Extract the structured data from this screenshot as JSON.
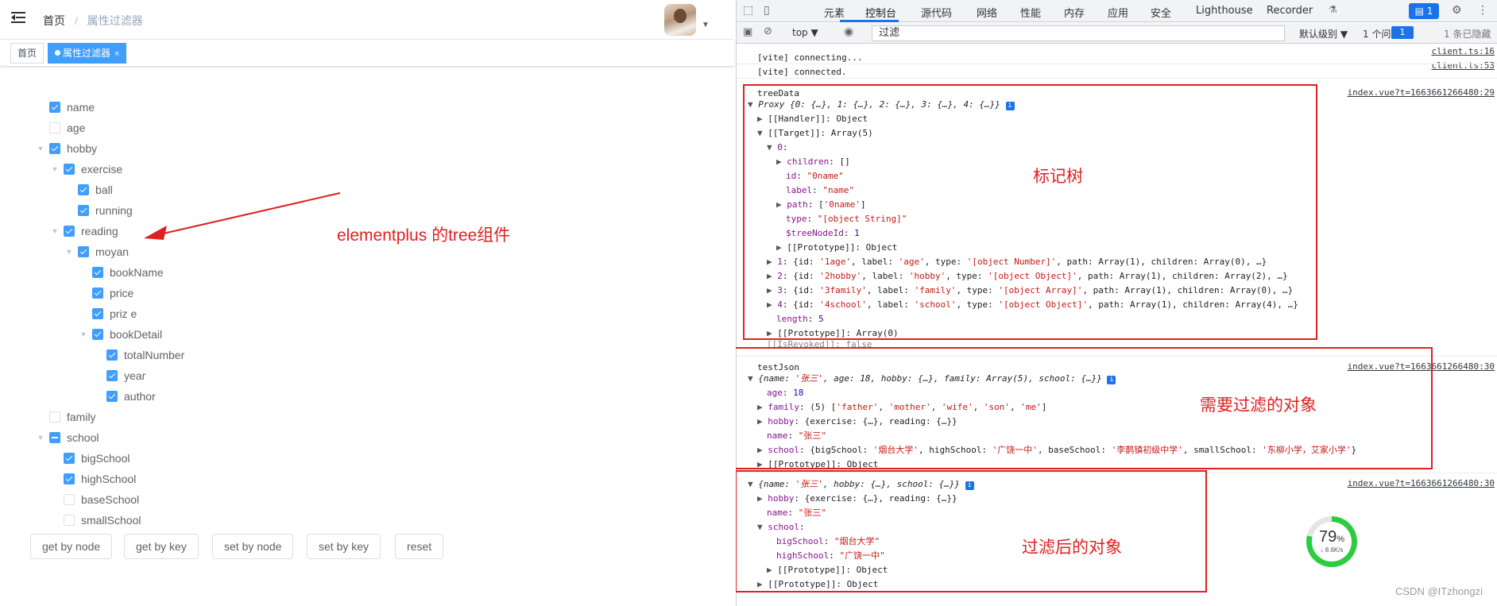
{
  "breadcrumb": {
    "home": "首页",
    "separator": "/",
    "current": "属性过滤器"
  },
  "tags": [
    {
      "label": "首页",
      "active": false
    },
    {
      "label": "属性过滤器",
      "active": true
    }
  ],
  "tree": [
    {
      "label": "name",
      "check": "on",
      "indent": 0,
      "arrow": ""
    },
    {
      "label": "age",
      "check": "off",
      "indent": 0,
      "arrow": ""
    },
    {
      "label": "hobby",
      "check": "on",
      "indent": 0,
      "arrow": "▼"
    },
    {
      "label": "exercise",
      "check": "on",
      "indent": 1,
      "arrow": "▼"
    },
    {
      "label": "ball",
      "check": "on",
      "indent": 2,
      "arrow": ""
    },
    {
      "label": "running",
      "check": "on",
      "indent": 2,
      "arrow": ""
    },
    {
      "label": "reading",
      "check": "on",
      "indent": 1,
      "arrow": "▼"
    },
    {
      "label": "moyan",
      "check": "on",
      "indent": 2,
      "arrow": "▼"
    },
    {
      "label": "bookName",
      "check": "on",
      "indent": 3,
      "arrow": ""
    },
    {
      "label": "price",
      "check": "on",
      "indent": 3,
      "arrow": ""
    },
    {
      "label": "priz e",
      "check": "on",
      "indent": 3,
      "arrow": ""
    },
    {
      "label": "bookDetail",
      "check": "on",
      "indent": 3,
      "arrow": "▼"
    },
    {
      "label": "totalNumber",
      "check": "on",
      "indent": 4,
      "arrow": ""
    },
    {
      "label": "year",
      "check": "on",
      "indent": 4,
      "arrow": ""
    },
    {
      "label": "author",
      "check": "on",
      "indent": 4,
      "arrow": ""
    },
    {
      "label": "family",
      "check": "off",
      "indent": 0,
      "arrow": ""
    },
    {
      "label": "school",
      "check": "half",
      "indent": 0,
      "arrow": "▼"
    },
    {
      "label": "bigSchool",
      "check": "on",
      "indent": 1,
      "arrow": ""
    },
    {
      "label": "highSchool",
      "check": "on",
      "indent": 1,
      "arrow": ""
    },
    {
      "label": "baseSchool",
      "check": "off",
      "indent": 1,
      "arrow": ""
    },
    {
      "label": "smallSchool",
      "check": "off",
      "indent": 1,
      "arrow": ""
    }
  ],
  "buttons": [
    "get by node",
    "get by key",
    "set by node",
    "set by key",
    "reset"
  ],
  "annotations": {
    "tree_component": "elementplus 的tree组件",
    "marked_tree": "标记树",
    "object_to_filter": "需要过滤的对象",
    "filtered_object": "过滤后的对象"
  },
  "devtools": {
    "tabs": [
      "元素",
      "控制台",
      "源代码",
      "网络",
      "性能",
      "内存",
      "应用",
      "安全",
      "Lighthouse",
      "Recorder"
    ],
    "active_tab": "控制台",
    "issues_badge": "1",
    "context": "top",
    "filter_value": "过滤",
    "level": "默认级别",
    "issues_text": "1 个问题:",
    "issues_count": "1",
    "hidden": "1 条已隐藏"
  },
  "console_lines": [
    "[vite] connecting...",
    "[vite] connected.",
    "treeData",
    "Proxy {0: {…}, 1: {…}, 2: {…}, 3: {…}, 4: {…}}",
    "[[Handler]]: Object",
    "[[Target]]: Array(5)",
    "0:",
    "children: []",
    "id: \"0name\"",
    "label: \"name\"",
    "path: ['0name']",
    "type: \"[object String]\"",
    "$treeNodeId: 1",
    "[[Prototype]]: Object",
    "1: {id: '1age', label: 'age', type: '[object Number]', path: Array(1), children: Array(0), …}",
    "2: {id: '2hobby', label: 'hobby', type: '[object Object]', path: Array(1), children: Array(2), …}",
    "3: {id: '3family', label: 'family', type: '[object Array]', path: Array(1), children: Array(0), …}",
    "4: {id: '4school', label: 'school', type: '[object Object]', path: Array(1), children: Array(4), …}",
    "length: 5",
    "[[Prototype]]: Array(0)",
    "[[IsRevoked]]: false",
    "testJson",
    "{name: '张三', age: 18, hobby: {…}, family: Array(5), school: {…}}",
    "age: 18",
    "family: (5) ['father', 'mother', 'wife', 'son', 'me']",
    "hobby: {exercise: {…}, reading: {…}}",
    "name: \"张三\"",
    "school: {bigSchool: '烟台大学', highSchool: '广饶一中', baseSchool: '李鹊镇初级中学', smallSchool: '东柳小学，艾家小学'}",
    "[[Prototype]]: Object",
    "{name: '张三', hobby: {…}, school: {…}}",
    "hobby: {exercise: {…}, reading: {…}}",
    "name: \"张三\"",
    "school:",
    "bigSchool: \"烟台大学\"",
    "highSchool: \"广饶一中\"",
    "[[Prototype]]: Object",
    "[[Prototype]]: Object"
  ],
  "sources": {
    "client1": "client.ts:16",
    "client2": "client.ts:53",
    "index1": "index.vue?t=1663661266480:29",
    "index2": "index.vue?t=1663661266480:30",
    "index3": "index.vue?t=1663661266480:30"
  },
  "perf": {
    "percent": "79",
    "unit": "%",
    "speed": "8.6K/s",
    "value": 0.79
  },
  "watermark": "CSDN @ITzhongzi",
  "colors": {
    "accent": "#409eff",
    "annotation": "#e02020",
    "devtools_accent": "#1a73e8"
  }
}
